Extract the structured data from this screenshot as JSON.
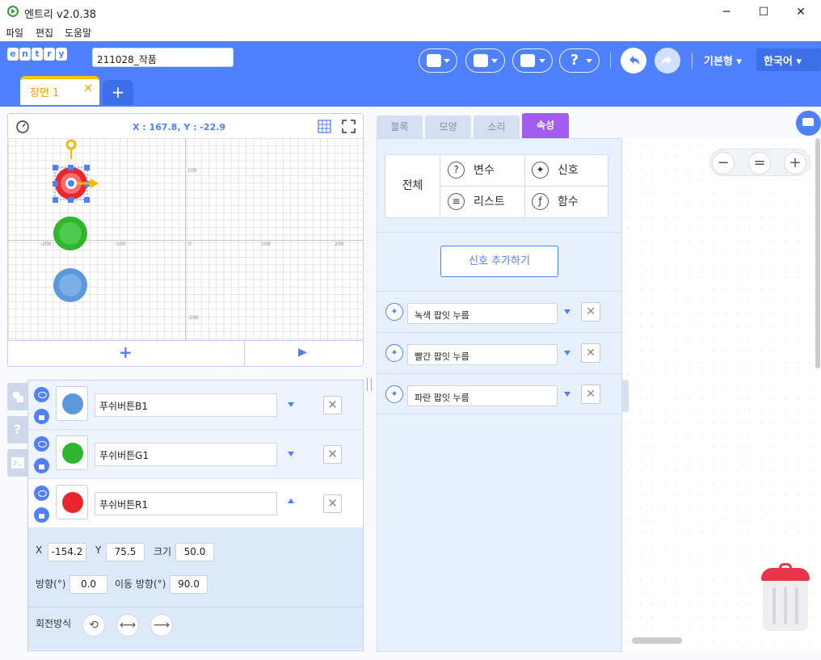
{
  "window": {
    "title": "엔트리 v2.0.38",
    "minimize": "─",
    "maximize": "☐",
    "close": "✕"
  },
  "menu": [
    "파일",
    "편집",
    "도움말"
  ],
  "header": {
    "logo_letters": [
      "e",
      "n",
      "t",
      "r",
      "y"
    ],
    "project_name": "211028_작품",
    "mode": "기본형 ▾",
    "language": "한국어  ▾",
    "brand_color": "#4f80ff"
  },
  "scene": {
    "tab_label": "장면 1",
    "close": "✕",
    "add": "+"
  },
  "stage": {
    "coordinates": "X : 167.8, Y : -22.9",
    "axis_labels": {
      "x_neg200": "-200",
      "x_neg100": "-100",
      "x_0": "0",
      "x_100": "100",
      "x_200": "200",
      "y_100": "100",
      "y_neg100": "-100"
    },
    "add_button": "+",
    "play_button": "▶"
  },
  "side_tabs": [
    "",
    "?",
    ""
  ],
  "objects": [
    {
      "name": "푸쉬버튼B1",
      "color": "#5b98dc",
      "expanded": false
    },
    {
      "name": "푸쉬버튼G1",
      "color": "#2fb52f",
      "expanded": false
    },
    {
      "name": "푸쉬버튼R1",
      "color": "#e8262e",
      "expanded": true
    }
  ],
  "object_delete": "✕",
  "properties": {
    "x_label": "X",
    "x_value": "-154.2",
    "y_label": "Y",
    "y_value": "75.5",
    "size_label": "크기",
    "size_value": "50.0",
    "direction_label": "방향(°)",
    "direction_value": "0.0",
    "move_direction_label": "이동 방향(°)",
    "move_direction_value": "90.0",
    "rotation_label": "회전방식",
    "rotation_buttons": [
      "⟲",
      "⟷",
      "⟶"
    ]
  },
  "palette_tabs": [
    "블록",
    "모양",
    "소리",
    "속성"
  ],
  "active_palette_tab": "속성",
  "categories": {
    "all": "전체",
    "items": [
      {
        "label": "변수",
        "icon": "question-icon",
        "glyph": "?"
      },
      {
        "label": "신호",
        "icon": "signal-icon",
        "glyph": "✦"
      },
      {
        "label": "리스트",
        "icon": "list-icon",
        "glyph": "≡"
      },
      {
        "label": "함수",
        "icon": "function-icon",
        "glyph": "ƒ"
      }
    ]
  },
  "add_signal_button": "신호 추가하기",
  "signals": [
    {
      "name": "녹색 팝잇 누름"
    },
    {
      "name": "빨간 팝잇 누름"
    },
    {
      "name": "파란 팝잇 누름"
    }
  ],
  "signal_delete": "✕",
  "zoom": {
    "out": "−",
    "reset": "=",
    "in": "+"
  }
}
